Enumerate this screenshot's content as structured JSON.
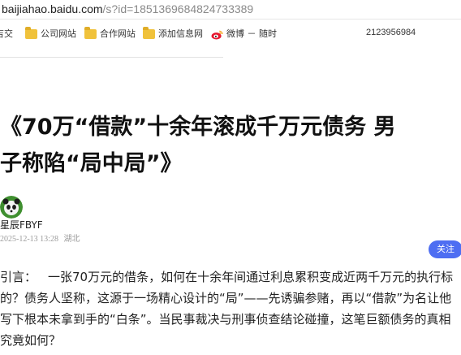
{
  "address_bar": {
    "host": "baijiahao.baidu.com",
    "path": "/s?id=1851369684824733389"
  },
  "bookmarks": {
    "items": [
      {
        "label": "吉交",
        "icon": "cut-off-item"
      },
      {
        "label": "公司网站",
        "icon": "folder-icon"
      },
      {
        "label": "合作网站",
        "icon": "folder-icon"
      },
      {
        "label": "添加信息网",
        "icon": "folder-icon"
      },
      {
        "label": "微博 － 随时",
        "icon": "weibo-icon"
      }
    ],
    "counter": "2123956984"
  },
  "article": {
    "title_line1": "《70万“借款”十余年滚成千万元债务 男",
    "title_line2": "子称陷“局中局”》",
    "author": "星辰FBYF",
    "date": "2025-12-13 13:28",
    "location": "湖北",
    "follow_label": "关注",
    "intro_label": "引言：",
    "intro_line1": "一张70万元的借条，如何在十余年间通过利息累积变成近两千万元的执行标",
    "intro_line2": "的？债务人坚称，这源于一场精心设计的“局”——先诱骗参赌，再以“借款”为名让他",
    "intro_line3": "写下根本未拿到手的“白条”。当民事裁决与刑事侦查结论碰撞，这笔巨额债务的真相",
    "intro_line4": "究竟如何？"
  },
  "colors": {
    "follow_button": "#4e6ef2",
    "folder": "#f0c23b",
    "meta_text": "#9a9a9a"
  }
}
